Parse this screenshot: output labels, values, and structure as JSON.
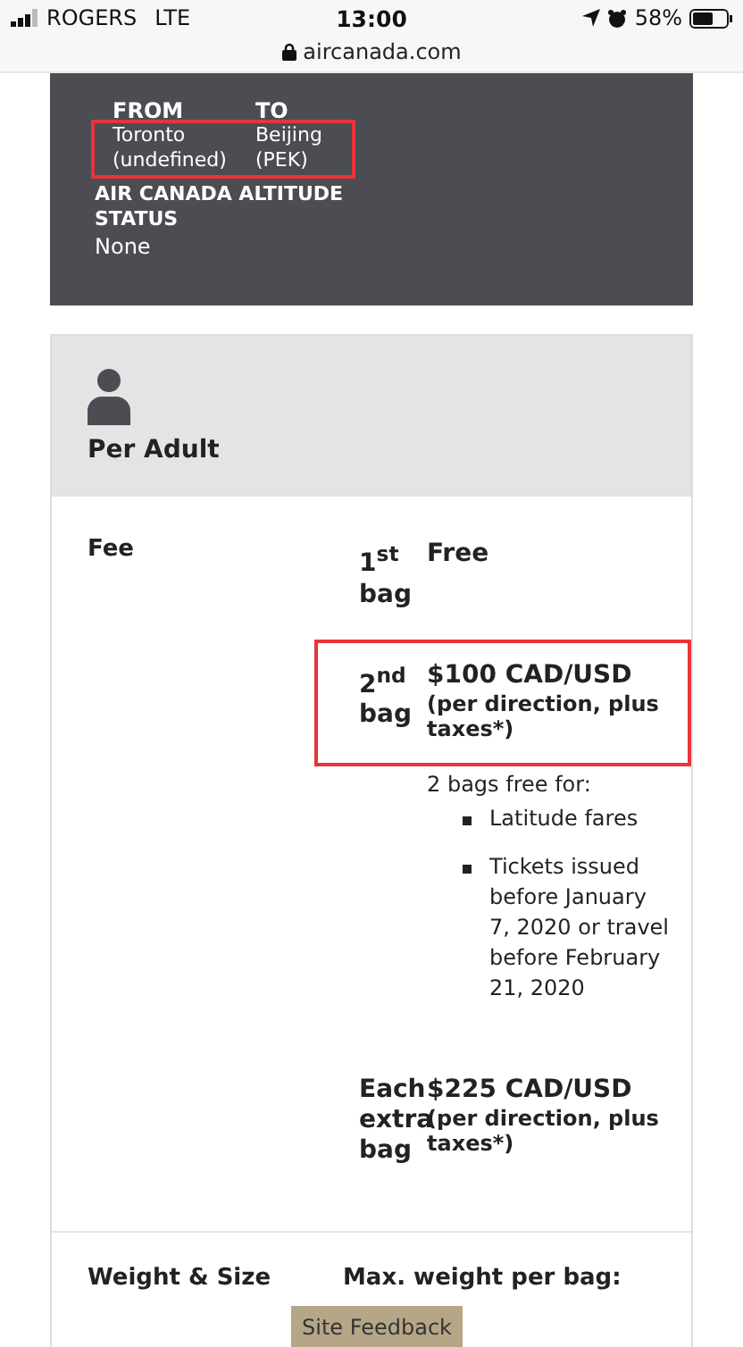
{
  "status_bar": {
    "carrier": "ROGERS",
    "network": "LTE",
    "time": "13:00",
    "battery": "58%",
    "url": "aircanada.com"
  },
  "trip": {
    "from_label": "FROM",
    "from_value": "Toronto (undefined)",
    "to_label": "TO",
    "to_value": "Beijing (PEK)",
    "highlighted": true,
    "status_label": "AIR CANADA ALTITUDE STATUS",
    "status_value": "None"
  },
  "passenger": {
    "label": "Per Adult"
  },
  "fee_section": {
    "label": "Fee",
    "rows": [
      {
        "kind": "fee",
        "bag": "1$^{st}$ bag",
        "amount": "Free",
        "detail": "",
        "highlighted": false
      },
      {
        "kind": "fee",
        "bag": "2$^{nd}$ bag",
        "amount": "$100 CAD/USD",
        "detail": "(per direction, plus taxes*)",
        "highlighted": true
      },
      {
        "kind": "note",
        "intro": "2 bags free for:",
        "items": [
          "Latitude fares",
          "Tickets issued before January 7, 2020 or travel before February 21, 2020"
        ]
      },
      {
        "kind": "fee",
        "bag": "Each extra bag",
        "amount": "$225 CAD/USD",
        "detail": "(per direction, plus taxes*)",
        "highlighted": false
      }
    ]
  },
  "weight_section": {
    "label": "Weight & Size",
    "value": "Max. weight per bag:"
  },
  "feedback_button": "Site Feedback"
}
